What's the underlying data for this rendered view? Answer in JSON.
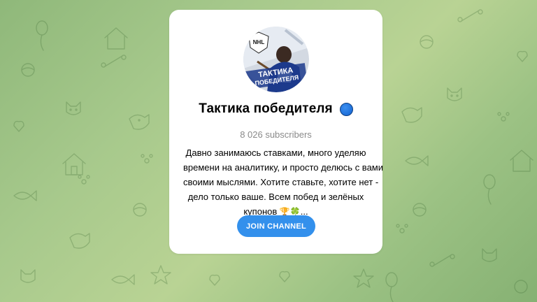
{
  "background": {
    "colors": [
      "#8fb87a",
      "#b9d394",
      "#86b173"
    ],
    "pattern_icons": [
      "cat-icon",
      "dog-icon",
      "ball-icon",
      "fish-icon",
      "house-icon",
      "balloon-icon"
    ]
  },
  "channel": {
    "title": "Тактика победителя",
    "title_badge_color": "#1e6fd9",
    "subscribers": "8 026 subscribers",
    "avatar": {
      "text_line1": "ТАКТИКА",
      "text_line2": "ПОБЕДИТЕЛЯ",
      "logo_text": "NHL",
      "colors": [
        "#1c3a8c",
        "#e9eef5",
        "#d0d8e4"
      ]
    },
    "description_lines": [
      "Давно занимаюсь ставками, много уделяю",
      "времени на аналитику, и просто делюсь с вами",
      "своими мыслями. Хотите ставьте, хотите нет -",
      "дело только ваше. Всем побед и зелёных"
    ],
    "description_last_text": "купонов",
    "description_emojis": [
      "🏆",
      "🍀"
    ],
    "description_ellipsis": "..."
  },
  "actions": {
    "join_label": "JOIN CHANNEL",
    "join_color": "#3390ec"
  }
}
